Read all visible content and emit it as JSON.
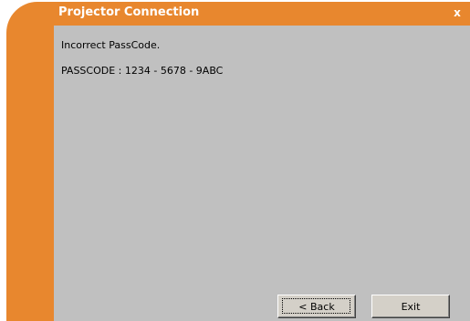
{
  "window": {
    "title": "Projector Connection",
    "close_label": "x"
  },
  "message": {
    "line1": "Incorrect PassCode.",
    "line2": "PASSCODE : 1234 - 5678 - 9ABC"
  },
  "buttons": {
    "back_label": "< Back",
    "exit_label": "Exit"
  },
  "colors": {
    "accent": "#e8872e",
    "content_bg": "#c0c0c0",
    "title_text": "#ffffff"
  }
}
